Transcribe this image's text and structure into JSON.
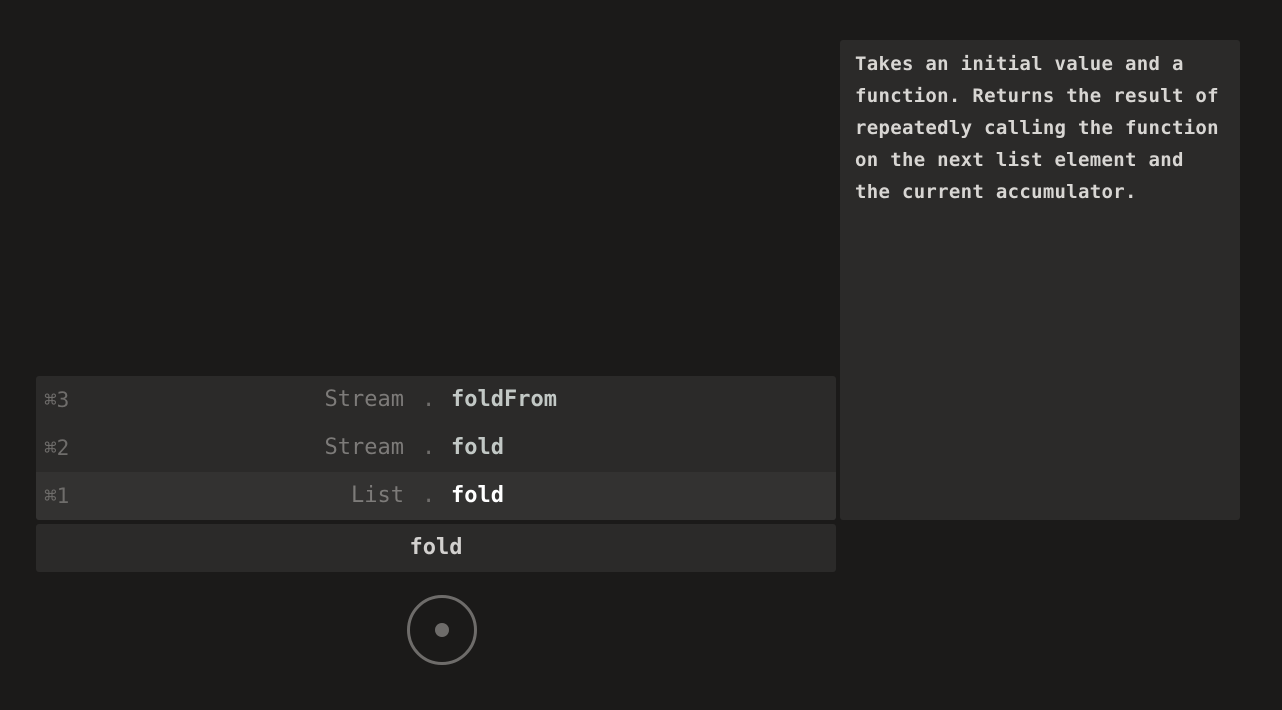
{
  "results": [
    {
      "shortcut": "⌘3",
      "module": "Stream",
      "separator": ".",
      "name": "foldFrom",
      "selected": false
    },
    {
      "shortcut": "⌘2",
      "module": "Stream",
      "separator": ".",
      "name": "fold",
      "selected": false
    },
    {
      "shortcut": "⌘1",
      "module": "List",
      "separator": ".",
      "name": "fold",
      "selected": true
    }
  ],
  "search": {
    "query": "fold"
  },
  "doc": {
    "text": "Takes an initial value and a function. Returns the result of repeatedly calling the function on the next list element and the current accumulator."
  },
  "spinner": {
    "icon": "loading-ring-icon"
  },
  "colors": {
    "background": "#1b1a19",
    "panel": "#2b2a29",
    "selected_row": "#333231",
    "muted_text": "#7d7b79",
    "function_text": "#c2c8c5",
    "selected_function_text": "#ffffff"
  }
}
